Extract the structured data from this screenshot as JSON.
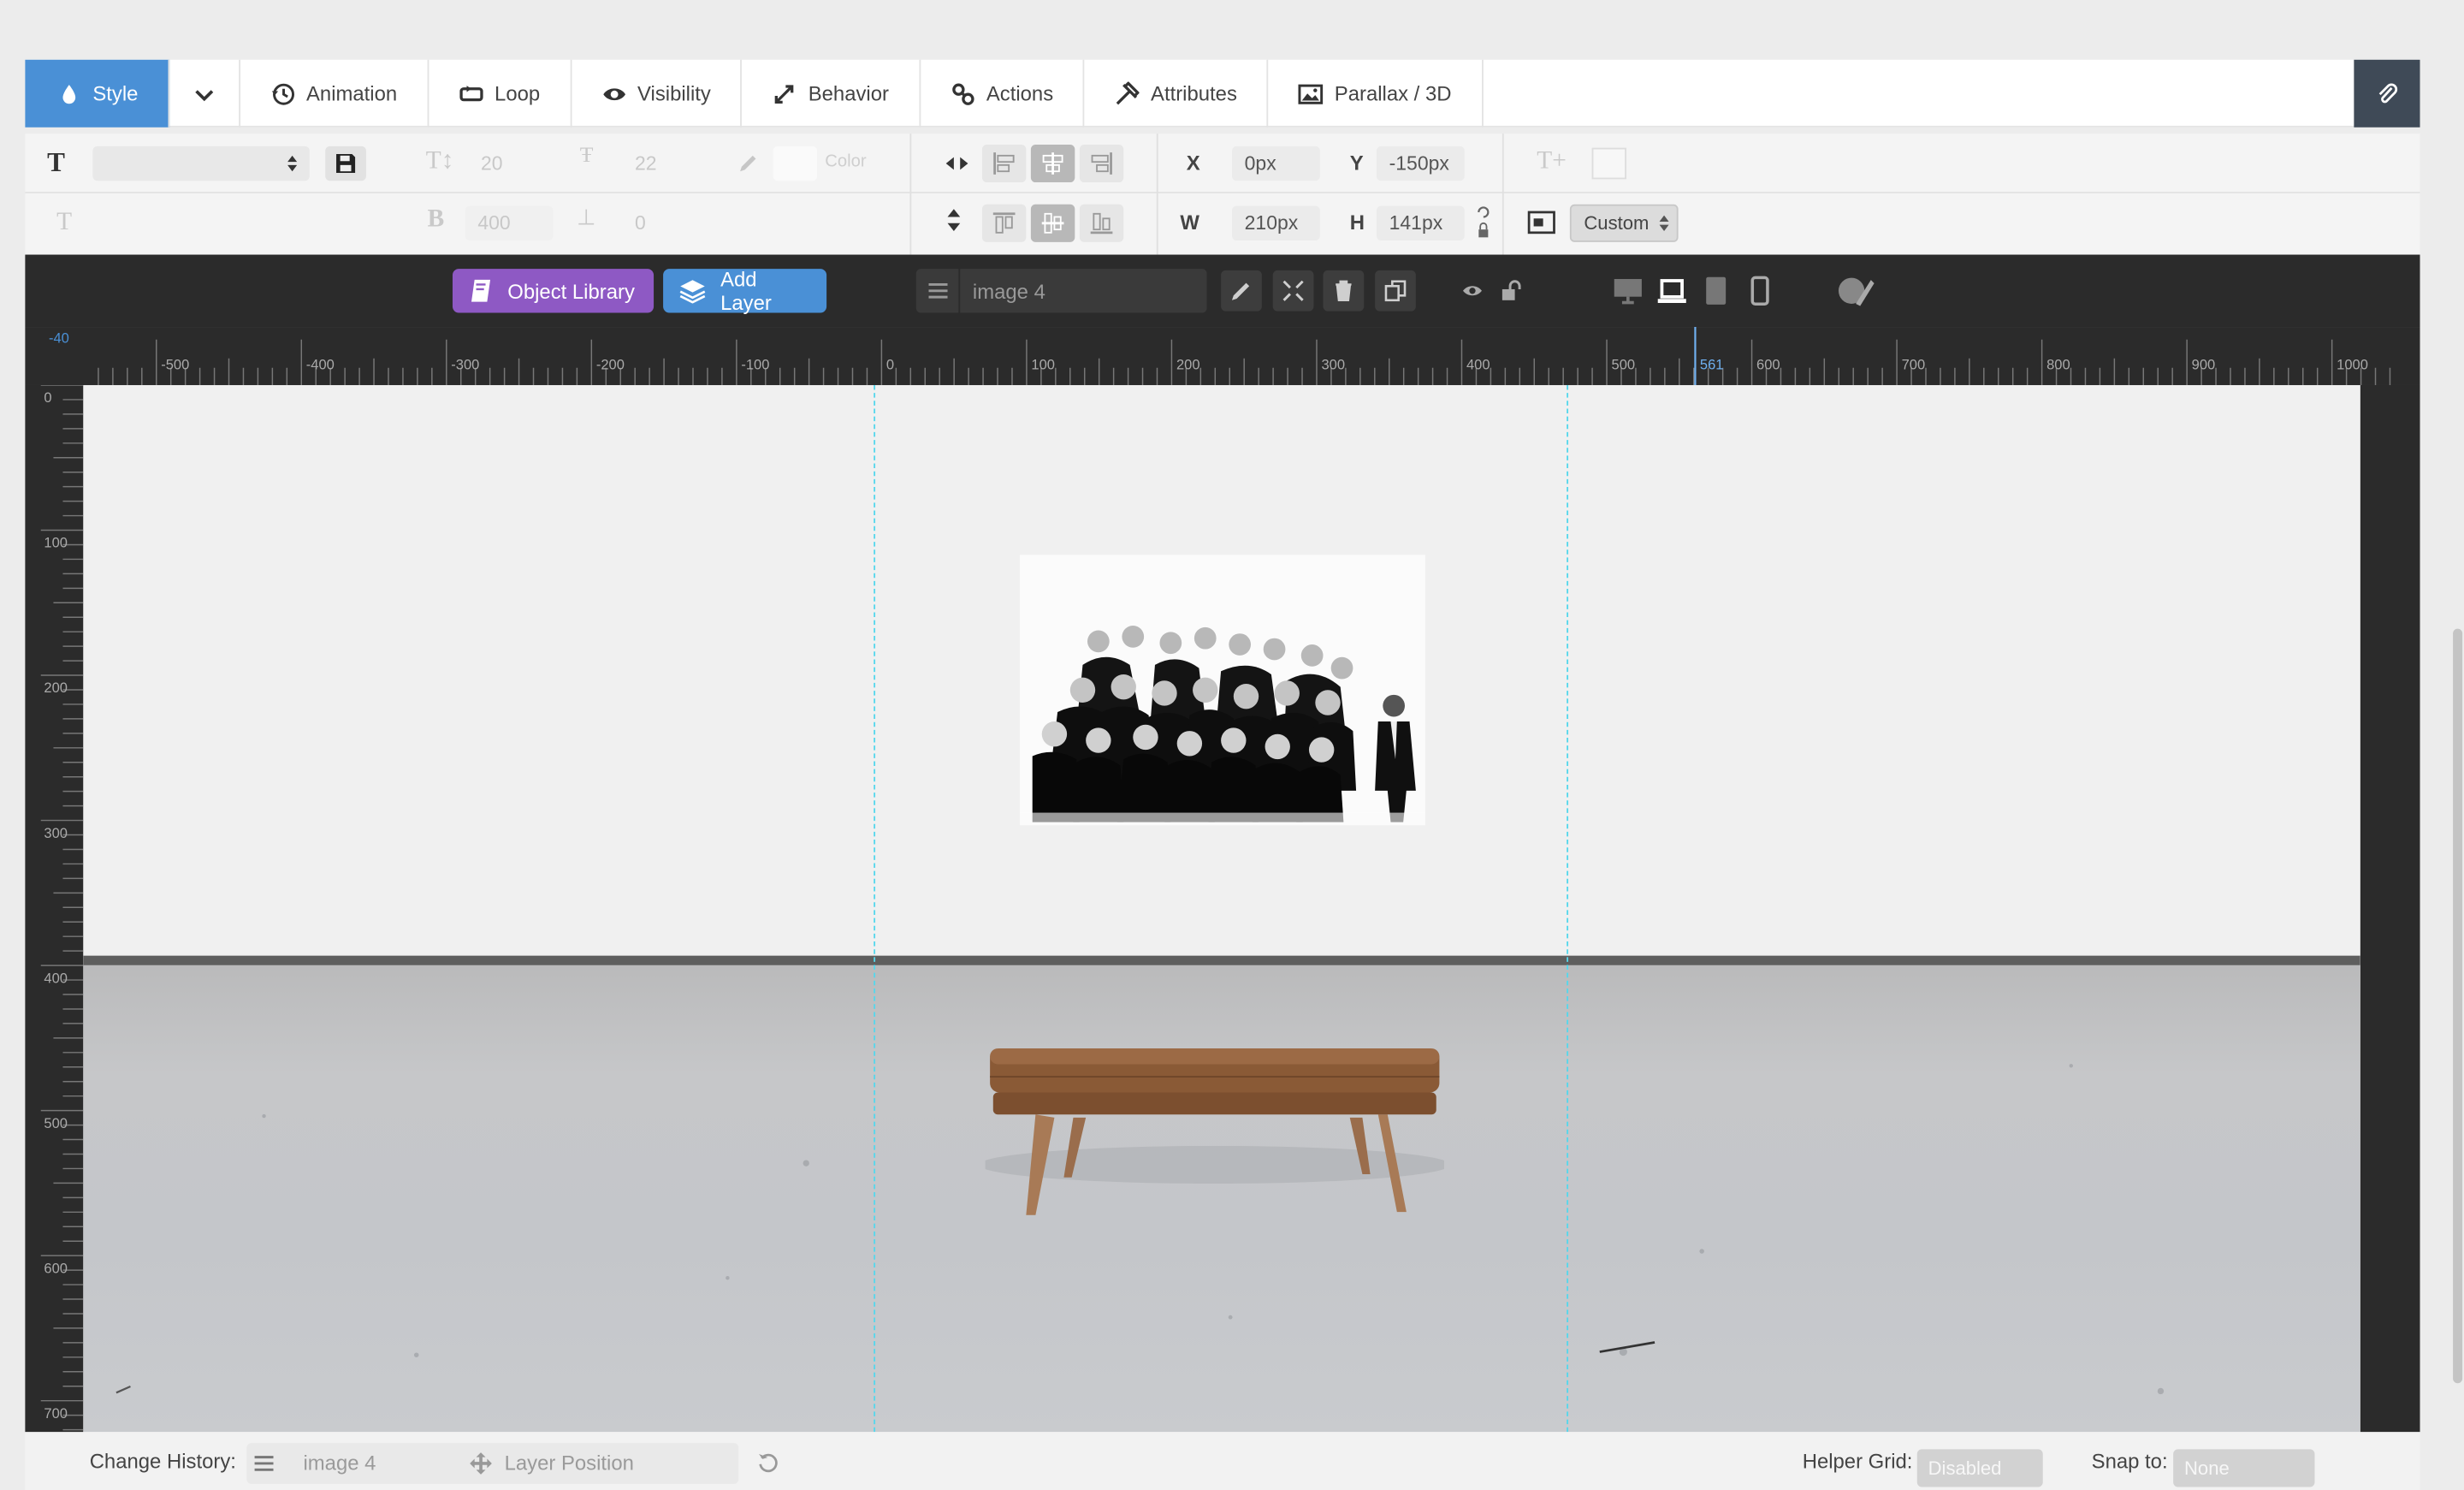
{
  "tabs": [
    {
      "label": "Style",
      "icon": "drop-icon",
      "active": true
    },
    {
      "label": "Animation",
      "icon": "history-icon"
    },
    {
      "label": "Loop",
      "icon": "loop-icon"
    },
    {
      "label": "Visibility",
      "icon": "eye-icon"
    },
    {
      "label": "Behavior",
      "icon": "resize-icon"
    },
    {
      "label": "Actions",
      "icon": "link-icon"
    },
    {
      "label": "Attributes",
      "icon": "tools-icon"
    },
    {
      "label": "Parallax / 3D",
      "icon": "image-icon"
    }
  ],
  "style": {
    "font_size": "20",
    "line_height": "22",
    "color_label": "Color",
    "font_weight": "400",
    "letter_spacing": "0",
    "x_label": "X",
    "x_value": "0px",
    "y_label": "Y",
    "y_value": "-150px",
    "w_label": "W",
    "w_value": "210px",
    "h_label": "H",
    "h_value": "141px",
    "size_preset": "Custom"
  },
  "toolbar": {
    "object_library": "Object Library",
    "add_layer": "Add Layer",
    "layer_name": "image 4"
  },
  "ruler_top": {
    "labels": [
      "-500",
      "-400",
      "-300",
      "-200",
      "-100",
      "0",
      "100",
      "200",
      "300",
      "400",
      "500",
      "561",
      "600",
      "700",
      "800",
      "900",
      "1000"
    ],
    "marker": "561",
    "corner": "-40"
  },
  "ruler_left": {
    "labels": [
      "0",
      "100",
      "200",
      "300",
      "400",
      "500",
      "600",
      "700"
    ]
  },
  "bottom": {
    "change_history_label": "Change History:",
    "history_layer": "image 4",
    "history_action": "Layer Position",
    "helper_grid_label": "Helper Grid:",
    "helper_grid_value": "Disabled",
    "snap_label": "Snap to:",
    "snap_value": "None"
  },
  "colors": {
    "accent": "#4a90d6",
    "library": "#8e59c4",
    "guide": "#55d7ec",
    "toolbar": "#2b2b2b"
  }
}
